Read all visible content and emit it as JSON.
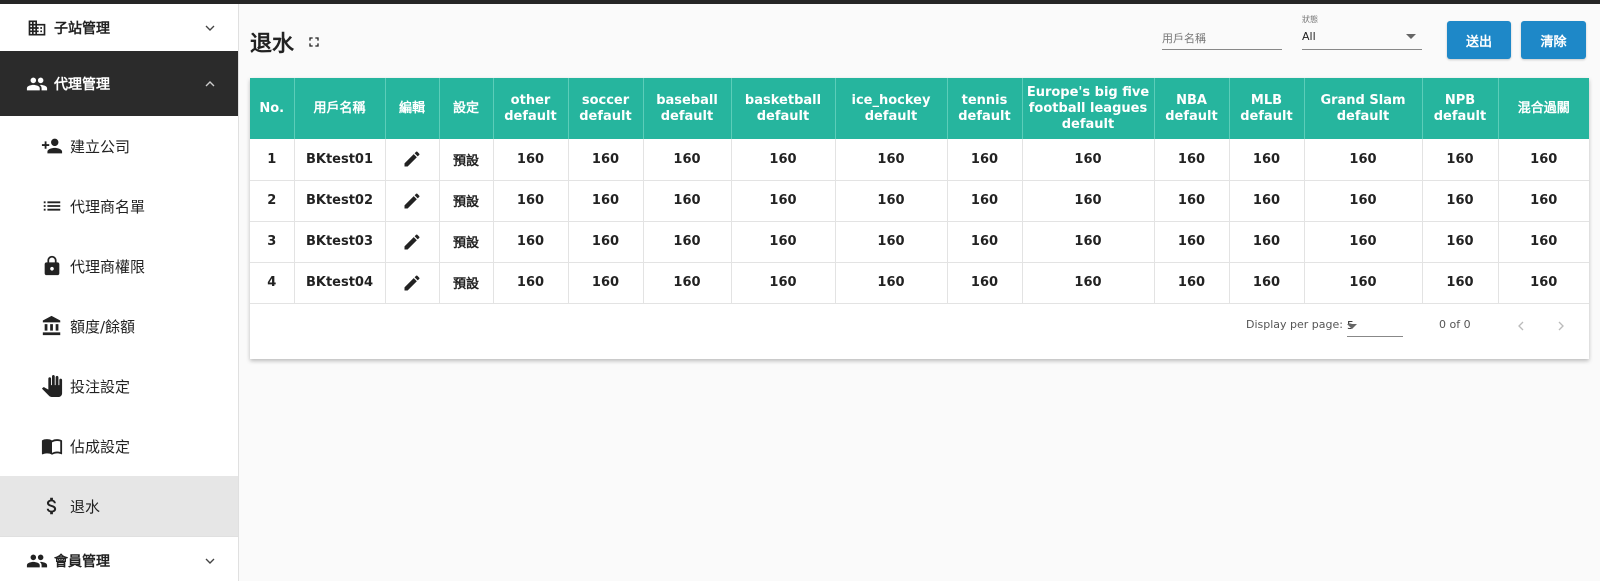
{
  "sidebar": {
    "groups": [
      {
        "label": "子站管理"
      },
      {
        "label": "代理管理"
      },
      {
        "label": "會員管理"
      }
    ],
    "items": [
      {
        "label": "建立公司"
      },
      {
        "label": "代理商名單"
      },
      {
        "label": "代理商權限"
      },
      {
        "label": "額度/餘額"
      },
      {
        "label": "投注設定"
      },
      {
        "label": "佔成設定"
      },
      {
        "label": "退水"
      }
    ]
  },
  "header": {
    "title": "退水",
    "user_placeholder": "用戶名稱",
    "status_label": "狀態",
    "status_value": "All",
    "submit_label": "送出",
    "clear_label": "清除"
  },
  "table": {
    "columns": [
      "No.",
      "用戶名稱",
      "編輯",
      "設定",
      "other default",
      "soccer default",
      "baseball default",
      "basketball default",
      "ice_hockey default",
      "tennis default",
      "Europe's big five football leagues default",
      "NBA default",
      "MLB default",
      "Grand Slam default",
      "NPB default",
      "混合過關"
    ],
    "rows": [
      {
        "no": "1",
        "user": "BKtest01",
        "setting": "預設",
        "values": [
          "160",
          "160",
          "160",
          "160",
          "160",
          "160",
          "160",
          "160",
          "160",
          "160",
          "160",
          "160"
        ]
      },
      {
        "no": "2",
        "user": "BKtest02",
        "setting": "預設",
        "values": [
          "160",
          "160",
          "160",
          "160",
          "160",
          "160",
          "160",
          "160",
          "160",
          "160",
          "160",
          "160"
        ]
      },
      {
        "no": "3",
        "user": "BKtest03",
        "setting": "預設",
        "values": [
          "160",
          "160",
          "160",
          "160",
          "160",
          "160",
          "160",
          "160",
          "160",
          "160",
          "160",
          "160"
        ]
      },
      {
        "no": "4",
        "user": "BKtest04",
        "setting": "預設",
        "values": [
          "160",
          "160",
          "160",
          "160",
          "160",
          "160",
          "160",
          "160",
          "160",
          "160",
          "160",
          "160"
        ]
      }
    ]
  },
  "pagination": {
    "per_page_label": "Display per page:",
    "per_page_value": "5",
    "range": "0 of 0"
  },
  "colors": {
    "accent": "#26b59e",
    "button": "#1e88c8",
    "sidebar_active": "#2b2b2b"
  }
}
